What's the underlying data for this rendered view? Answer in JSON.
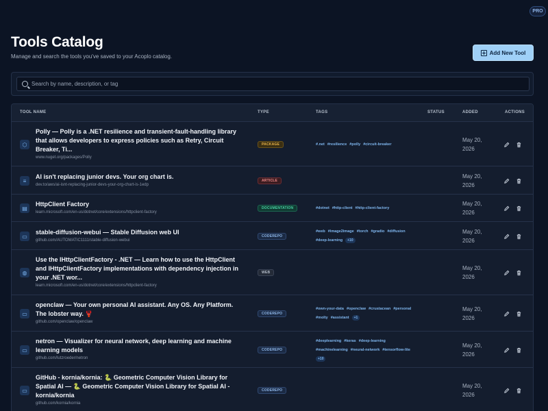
{
  "badge": "PRO",
  "header": {
    "title": "Tools Catalog",
    "subtitle": "Manage and search the tools you've saved to your Acoplo catalog.",
    "add_button": "Add New Tool"
  },
  "search": {
    "placeholder": "Search by name, description, or tag"
  },
  "table": {
    "columns": [
      "TOOL NAME",
      "TYPE",
      "TAGS",
      "STATUS",
      "ADDED",
      "ACTIONS"
    ],
    "rows": [
      {
        "icon": "package-icon",
        "title": "Polly — Polly is a .NET resilience and transient-fault-handling library that allows developers to express policies such as Retry, Circuit Breaker, Ti...",
        "url": "www.nuget.org/packages/Polly",
        "type": "PACKAGE",
        "tags": [
          "#.net",
          "#resilience",
          "#polly",
          "#circuit-breaker"
        ],
        "more": "",
        "added": "May 20, 2026"
      },
      {
        "icon": "article-icon",
        "title": "AI isn't replacing junior devs. Your org chart is.",
        "url": "dev.to/aws/ai-isnt-replacing-junior-devs-your-org-chart-is-1edp",
        "type": "ARTICLE",
        "tags": [],
        "more": "",
        "added": "May 20, 2026"
      },
      {
        "icon": "documentation-icon",
        "title": "HttpClient Factory",
        "url": "learn.microsoft.com/en-us/dotnet/core/extensions/httpclient-factory",
        "type": "DOCUMENTATION",
        "tags": [
          "#dotnet",
          "#http-client",
          "#http-client-factory"
        ],
        "more": "",
        "added": "May 20, 2026"
      },
      {
        "icon": "code-repo-icon",
        "title": "stable-diffusion-webui — Stable Diffusion web UI",
        "url": "github.com/AUTOMATIC1111/stable-diffusion-webui",
        "type": "CODEREPO",
        "tags": [
          "#web",
          "#image2image",
          "#torch",
          "#gradio",
          "#diffusion",
          "#deep-learning"
        ],
        "more": "+10",
        "added": "May 20, 2026"
      },
      {
        "icon": "globe-icon",
        "title": "Use the IHttpClientFactory - .NET — Learn how to use the HttpClient and IHttpClientFactory implementations with dependency injection in your .NET wor...",
        "url": "learn.microsoft.com/en-us/dotnet/core/extensions/httpclient-factory",
        "type": "WEB",
        "tags": [],
        "more": "",
        "added": "May 20, 2026"
      },
      {
        "icon": "code-repo-icon",
        "title": "openclaw — Your own personal AI assistant. Any OS. Any Platform. The lobster way. 🦞",
        "url": "github.com/openclaw/openclaw",
        "type": "CODEREPO",
        "tags": [
          "#own-your-data",
          "#openclaw",
          "#crustacean",
          "#personal",
          "#molty",
          "#assistant"
        ],
        "more": "+1",
        "added": "May 20, 2026"
      },
      {
        "icon": "code-repo-icon",
        "title": "netron — Visualizer for neural network, deep learning and machine learning models",
        "url": "github.com/lutzroeder/netron",
        "type": "CODEREPO",
        "tags": [
          "#deeplearning",
          "#keras",
          "#deep-learning",
          "#machinelearning",
          "#neural-network",
          "#tensorflow-lite"
        ],
        "more": "+10",
        "added": "May 20, 2026"
      },
      {
        "icon": "code-repo-icon",
        "title": "GitHub - kornia/kornia: 🐍 Geometric Computer Vision Library for Spatial AI — 🐍 Geometric Computer Vision Library for Spatial AI - kornia/kornia",
        "url": "github.com/kornia/kornia",
        "type": "CODEREPO",
        "tags": [],
        "more": "",
        "added": "May 20, 2026"
      }
    ]
  }
}
